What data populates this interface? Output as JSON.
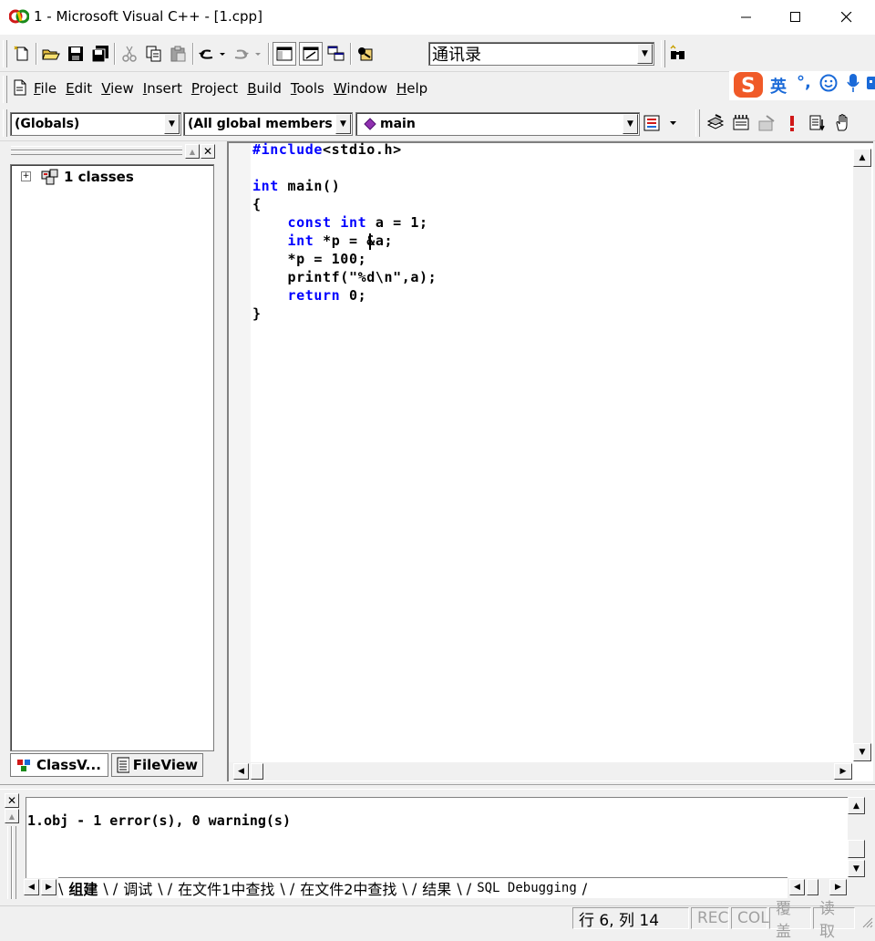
{
  "window": {
    "title": "1 - Microsoft Visual C++ - [1.cpp]",
    "minimize": "—",
    "maximize": "☐",
    "close": "✕"
  },
  "toolbar": {
    "workspace_combo": "通讯录"
  },
  "menu": {
    "items": [
      "File",
      "Edit",
      "View",
      "Insert",
      "Project",
      "Build",
      "Tools",
      "Window",
      "Help"
    ]
  },
  "ime": {
    "lang": "英",
    "punct": "°,"
  },
  "wizardbar": {
    "class_combo": "(Globals)",
    "filter_combo": "(All global members",
    "member_combo": "main"
  },
  "workspace": {
    "tree_root": "1 classes",
    "tabs": [
      "ClassV...",
      "FileView"
    ]
  },
  "editor": {
    "lines": [
      {
        "parts": [
          {
            "t": "#include",
            "kw": true
          },
          {
            "t": "<stdio.h>",
            "kw": false
          }
        ]
      },
      {
        "parts": []
      },
      {
        "parts": [
          {
            "t": "int",
            "kw": true
          },
          {
            "t": " main()",
            "kw": false
          }
        ]
      },
      {
        "parts": [
          {
            "t": "{",
            "kw": false
          }
        ]
      },
      {
        "parts": [
          {
            "t": "    ",
            "kw": false
          },
          {
            "t": "const",
            "kw": true
          },
          {
            "t": " ",
            "kw": false
          },
          {
            "t": "int",
            "kw": true
          },
          {
            "t": " a = 1;",
            "kw": false
          }
        ]
      },
      {
        "parts": [
          {
            "t": "    ",
            "kw": false
          },
          {
            "t": "int",
            "kw": true
          },
          {
            "t": " *p = &a;",
            "kw": false
          }
        ]
      },
      {
        "parts": [
          {
            "t": "    *p = 100;",
            "kw": false
          }
        ]
      },
      {
        "parts": [
          {
            "t": "    printf(\"%d\\n\",a);",
            "kw": false
          }
        ]
      },
      {
        "parts": [
          {
            "t": "    ",
            "kw": false
          },
          {
            "t": "return",
            "kw": true
          },
          {
            "t": " 0;",
            "kw": false
          }
        ]
      },
      {
        "parts": [
          {
            "t": "}",
            "kw": false
          }
        ]
      }
    ],
    "keyword_color": "#0000ff"
  },
  "output": {
    "message": "1.obj - 1 error(s), 0 warning(s)",
    "tabs": [
      "组建",
      "调试",
      "在文件1中查找",
      "在文件2中查找",
      "结果",
      "SQL Debugging"
    ]
  },
  "statusbar": {
    "position": "行 6, 列 14",
    "rec": "REC",
    "col": "COL",
    "ovr": "覆盖",
    "read": "读取"
  }
}
